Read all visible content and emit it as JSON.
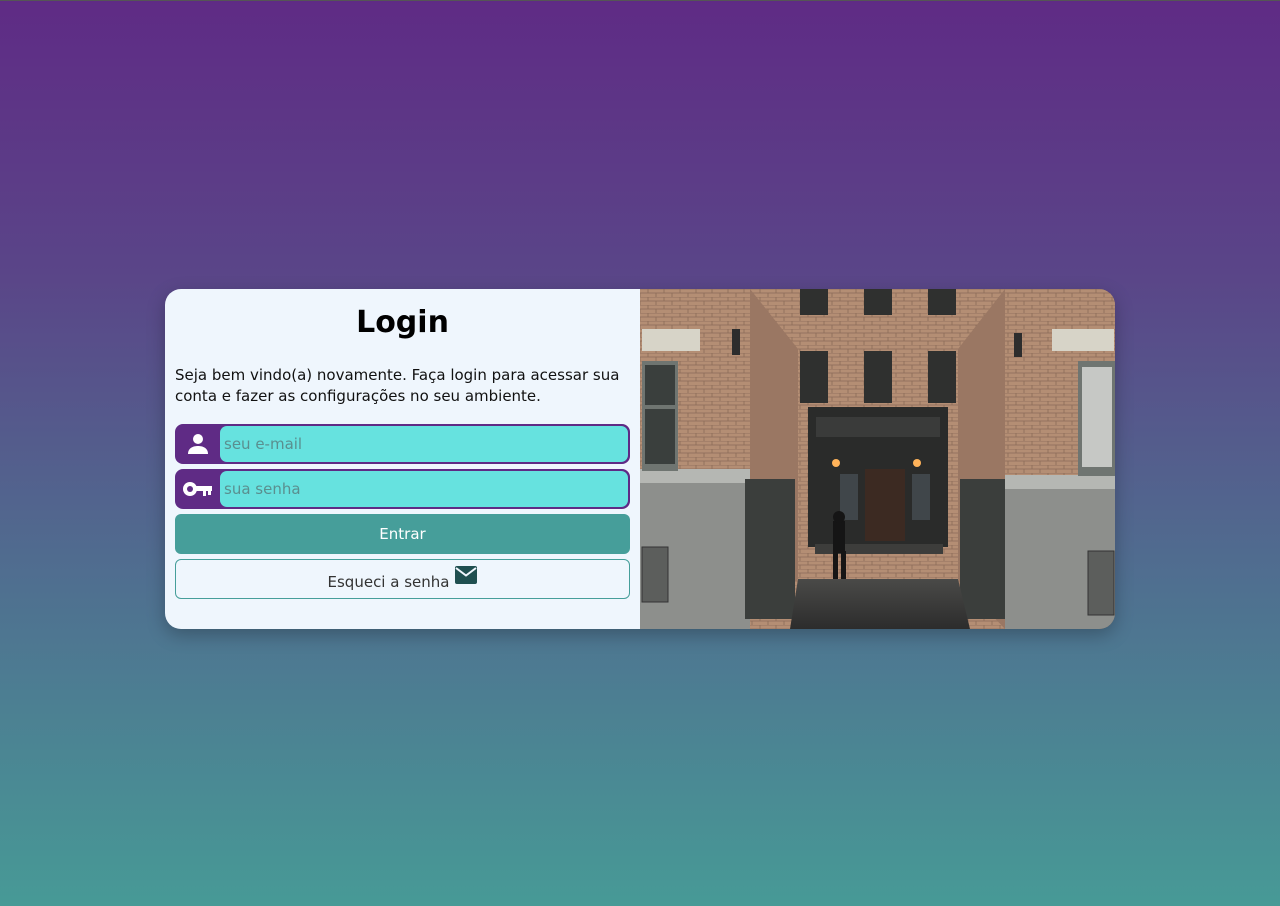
{
  "login": {
    "title": "Login",
    "description": "Seja bem vindo(a) novamente. Faça login para acessar sua conta e fazer as configurações no seu ambiente.",
    "email_placeholder": "seu e-mail",
    "password_placeholder": "sua senha",
    "submit_label": "Entrar",
    "forgot_label": "Esqueci a senha"
  },
  "icons": {
    "user": "person-icon",
    "key": "key-icon",
    "mail": "envelope-icon"
  },
  "colors": {
    "primary": "#5f2b85",
    "input_bg": "#66e2df",
    "button": "#469e9a",
    "card_bg": "#eff6fd"
  },
  "image": {
    "description": "brick apartment building entrance"
  }
}
